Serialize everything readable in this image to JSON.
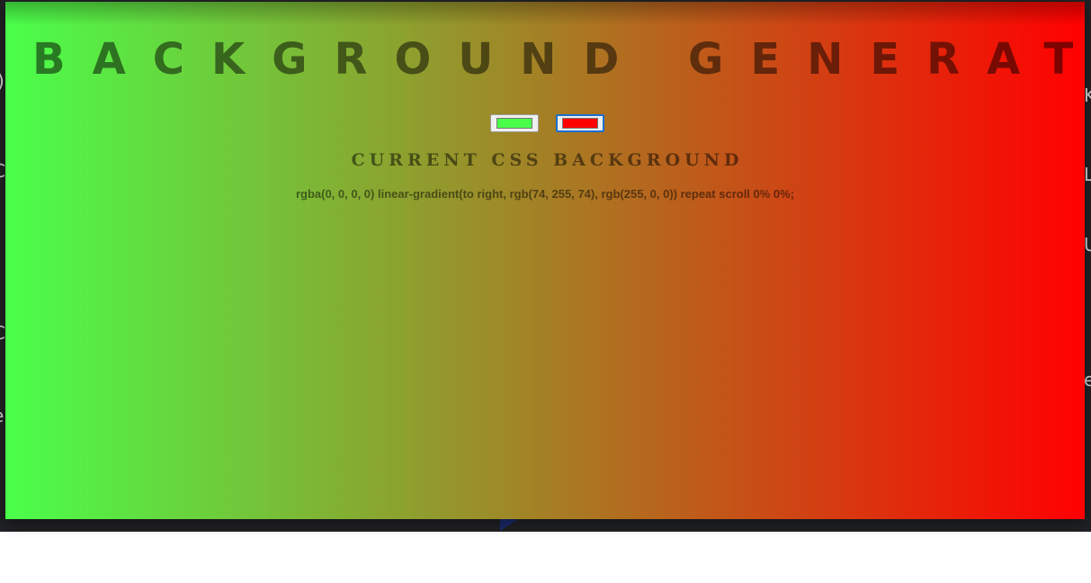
{
  "app": {
    "title": "BACKGROUND GENERATOR",
    "section_heading": "CURRENT CSS BACKGROUND",
    "css_output": "rgba(0, 0, 0, 0) linear-gradient(to right, rgb(74, 255, 74), rgb(255, 0, 0)) repeat scroll 0% 0%;",
    "color1": "#4aff4a",
    "color2": "#ff0000"
  },
  "colors": {
    "gradient_start": "#4aff4a",
    "gradient_end": "#ff0000",
    "active_focus": "#1a6fd1",
    "page_backdrop": "#202124"
  },
  "backdrop_fragments": [
    ")",
    "K",
    "C",
    "L",
    "U",
    "C",
    "e",
    "e"
  ]
}
